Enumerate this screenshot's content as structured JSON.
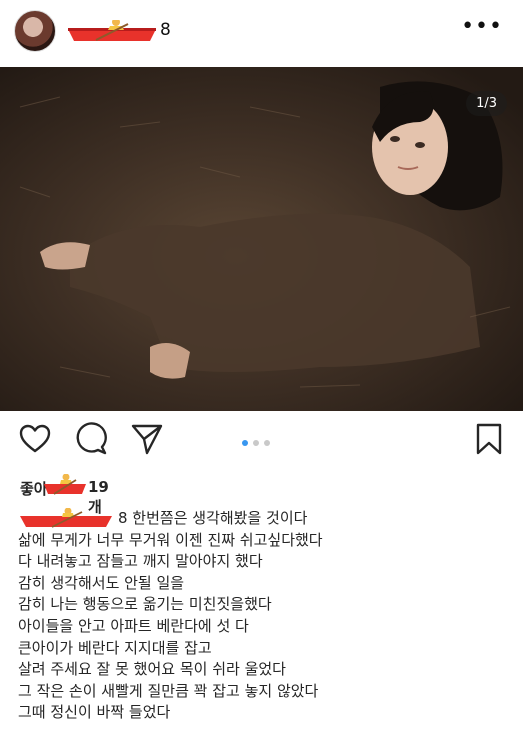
{
  "post": {
    "username_tail": "8",
    "more_label": "•••",
    "slide_counter": "1/3",
    "likes_tail": "19개",
    "caption_tail": "8 한번쯤은 생각해봤을 것이다",
    "caption_lines": [
      "삶에 무게가 너무 무거워 이젠 진짜 쉬고싶다했다",
      "다 내려놓고  잠들고 깨지 말아야지 했다",
      "감히 생각해서도 안될 일을",
      "감히 나는 행동으로 옮기는 미친짓을했다",
      "아이들을 안고 아파트 베란다에 섯 다",
      "큰아이가 베란다 지지대를 잡고",
      "살려 주세요 잘 못 했어요 목이 쉬라 울었다",
      "그 작은 손이 새빨게 질만큼 꽉 잡고 놓지 않았다",
      "그때 정신이 바짝 들었다"
    ],
    "carousel": {
      "count": 3,
      "active_index": 0
    }
  },
  "colors": {
    "accent": "#3897f0",
    "text": "#262626",
    "boat_red": "#e8322b"
  },
  "icons": [
    "avatar",
    "rowboat-emoji-icon",
    "more-icon",
    "heart-icon",
    "comment-icon",
    "share-icon",
    "bookmark-icon"
  ]
}
